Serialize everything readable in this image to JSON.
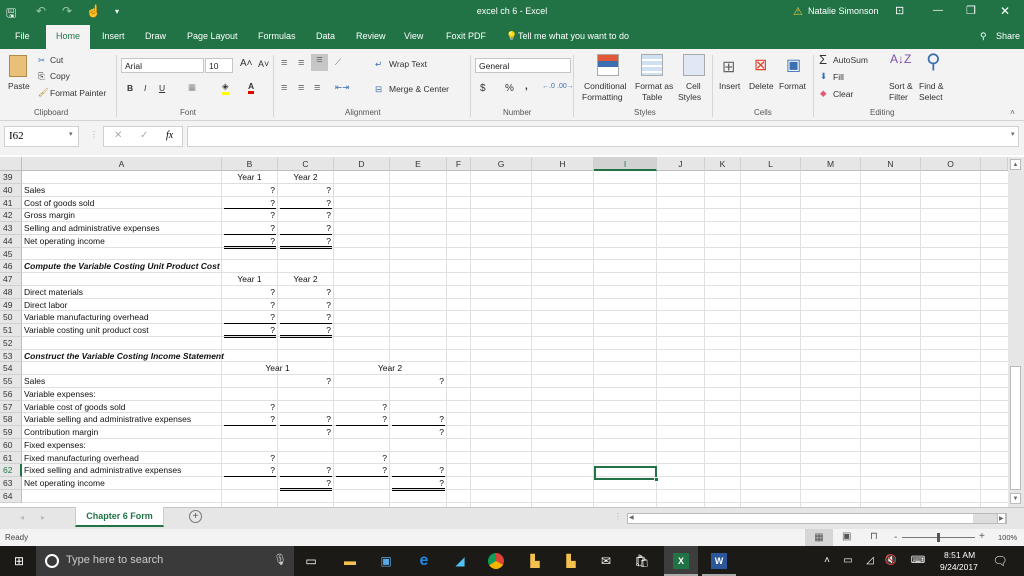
{
  "window": {
    "title": "excel ch 6  -  Excel",
    "user": "Natalie Simonson",
    "controls": {
      "restore_ribbon": "⊡",
      "minimize": "—",
      "maximize": "❐",
      "close": "✕"
    }
  },
  "ribbon_tabs": [
    "File",
    "Home",
    "Insert",
    "Draw",
    "Page Layout",
    "Formulas",
    "Data",
    "Review",
    "View",
    "Foxit PDF"
  ],
  "active_tab": "Home",
  "tell_me": "Tell me what you want to do",
  "share": "Share",
  "clipboard": {
    "paste": "Paste",
    "cut": "Cut",
    "copy": "Copy",
    "format_painter": "Format Painter",
    "group": "Clipboard"
  },
  "font": {
    "name": "Arial",
    "size": "10",
    "bold": "B",
    "italic": "I",
    "underline": "U",
    "group": "Font"
  },
  "alignment": {
    "wrap_text": "Wrap Text",
    "merge_center": "Merge & Center",
    "group": "Alignment"
  },
  "number": {
    "format": "General",
    "currency": "$",
    "percent": "%",
    "comma": ",",
    "group": "Number"
  },
  "styles": {
    "conditional": "Conditional",
    "conditional2": "Formatting",
    "format_as": "Format as",
    "format_as2": "Table",
    "cell": "Cell",
    "cell2": "Styles",
    "group": "Styles"
  },
  "cells": {
    "insert": "Insert",
    "delete": "Delete",
    "format": "Format",
    "group": "Cells"
  },
  "editing": {
    "autosum": "AutoSum",
    "fill": "Fill",
    "clear": "Clear",
    "sort": "Sort &",
    "sort2": "Filter",
    "find": "Find &",
    "find2": "Select",
    "group": "Editing"
  },
  "formula_bar": {
    "name_box": "I62",
    "formula": "",
    "fx": "fx"
  },
  "columns": [
    "A",
    "B",
    "C",
    "D",
    "E",
    "F",
    "G",
    "H",
    "I",
    "J",
    "K",
    "L",
    "M",
    "N",
    "O"
  ],
  "selected_column": "I",
  "selected_row": "62",
  "rows": [
    "39",
    "40",
    "41",
    "42",
    "43",
    "44",
    "45",
    "46",
    "47",
    "48",
    "49",
    "50",
    "51",
    "52",
    "53",
    "54",
    "55",
    "56",
    "57",
    "58",
    "59",
    "60",
    "61",
    "62",
    "63",
    "64"
  ],
  "sheet": {
    "r39": {
      "B": "Year 1",
      "C": "Year 2"
    },
    "r40": {
      "A": "Sales",
      "B": "?",
      "C": "?"
    },
    "r41": {
      "A": "Cost of goods sold",
      "B": "?",
      "C": "?"
    },
    "r42": {
      "A": "Gross margin",
      "B": "?",
      "C": "?"
    },
    "r43": {
      "A": "Selling and administrative expenses",
      "B": "?",
      "C": "?"
    },
    "r44": {
      "A": "Net operating income",
      "B": "?",
      "C": "?"
    },
    "r46": {
      "A": "Compute the Variable Costing Unit Product Cost"
    },
    "r47": {
      "B": "Year 1",
      "C": "Year 2"
    },
    "r48": {
      "A": "Direct materials",
      "B": "?",
      "C": "?"
    },
    "r49": {
      "A": "Direct labor",
      "B": "?",
      "C": "?"
    },
    "r50": {
      "A": "Variable manufacturing overhead",
      "B": "?",
      "C": "?"
    },
    "r51": {
      "A": "Variable costing unit product cost",
      "B": "?",
      "C": "?"
    },
    "r53": {
      "A": "Construct the Variable Costing Income Statement"
    },
    "r54": {
      "BC": "Year 1",
      "DE": "Year 2"
    },
    "r55": {
      "A": "Sales",
      "C": "?",
      "E": "?"
    },
    "r56": {
      "A": "Variable expenses:"
    },
    "r57": {
      "A": "  Variable cost of goods sold",
      "B": "?",
      "D": "?"
    },
    "r58": {
      "A": "  Variable selling and administrative expenses",
      "B": "?",
      "C": "?",
      "D": "?",
      "E": "?"
    },
    "r59": {
      "A": "Contribution margin",
      "C": "?",
      "E": "?"
    },
    "r60": {
      "A": "Fixed expenses:"
    },
    "r61": {
      "A": "  Fixed manufacturing overhead",
      "B": "?",
      "D": "?"
    },
    "r62": {
      "A": "  Fixed selling and administrative expenses",
      "B": "?",
      "C": "?",
      "D": "?",
      "E": "?"
    },
    "r63": {
      "A": "Net operating income",
      "C": "?",
      "E": "?"
    }
  },
  "sheet_tabs": [
    "Chapter 6 Form"
  ],
  "status": {
    "ready": "Ready",
    "zoom": "100%"
  },
  "taskbar": {
    "search_placeholder": "Type here to search",
    "time": "8:51 AM",
    "date": "9/24/2017"
  },
  "colors": {
    "excel_green": "#217346",
    "selection": "#217346"
  }
}
